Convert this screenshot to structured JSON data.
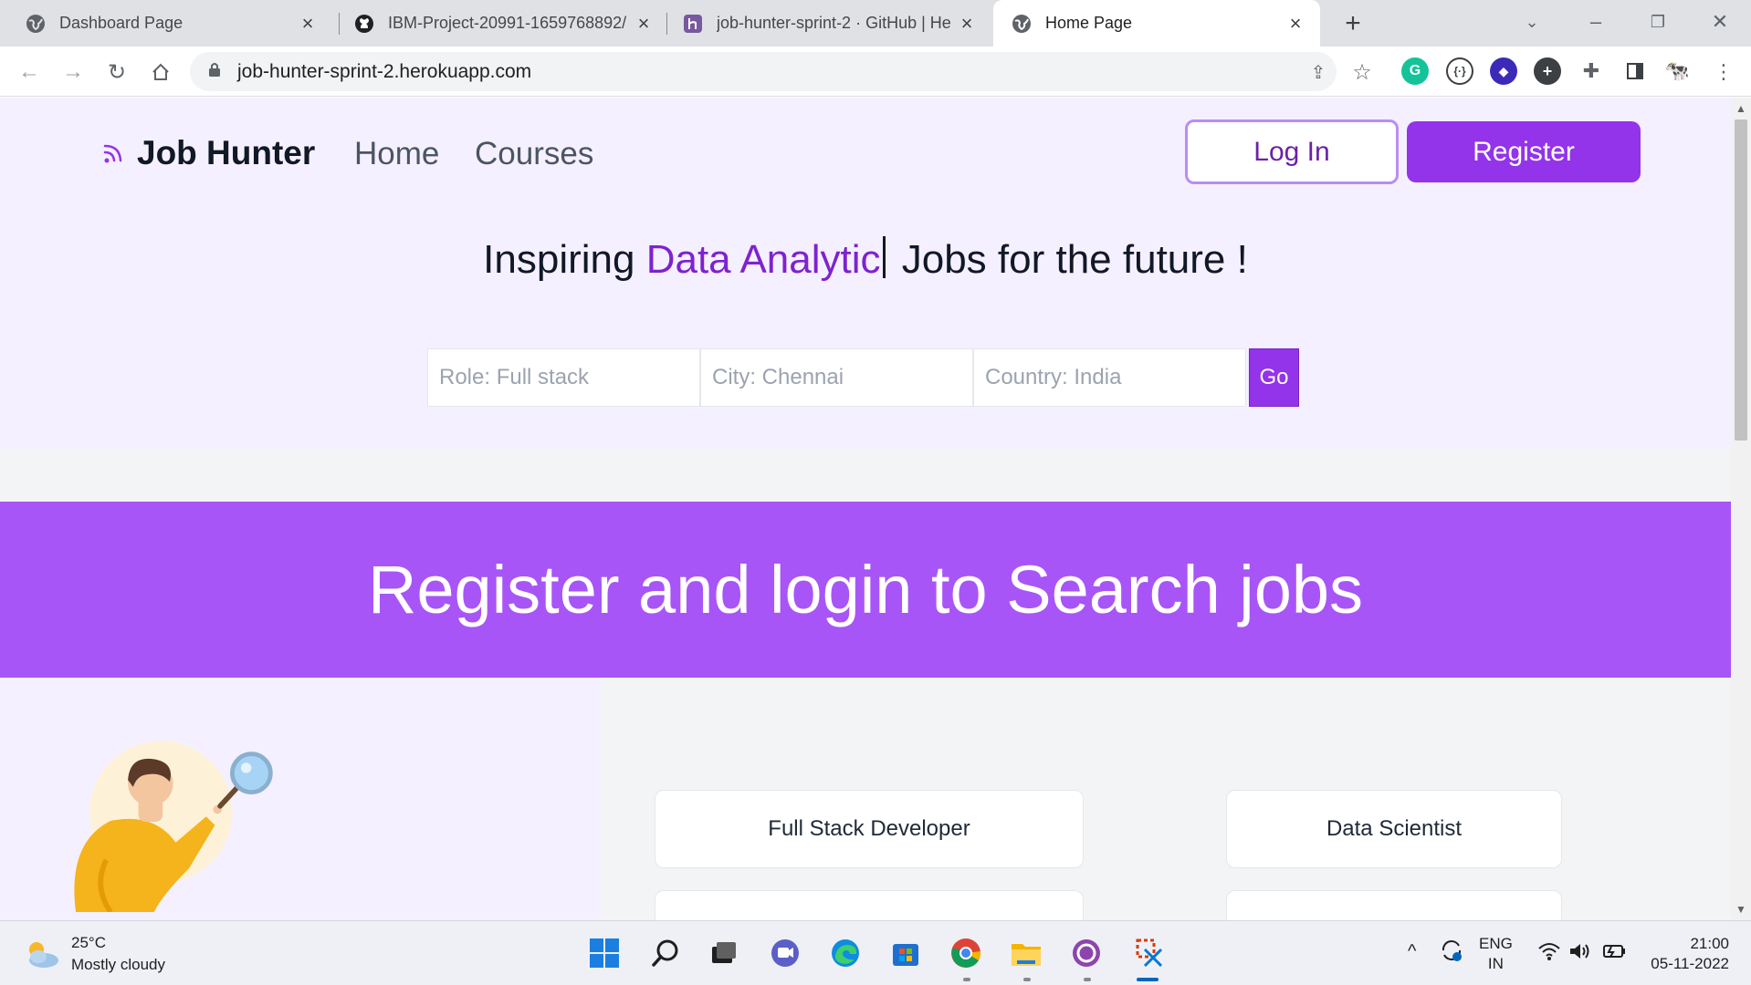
{
  "browser": {
    "tabs": [
      {
        "title": "Dashboard Page",
        "favicon": "globe-icon",
        "active": false
      },
      {
        "title": "IBM-Project-20991-1659768892/",
        "favicon": "github-icon",
        "active": false
      },
      {
        "title": "job-hunter-sprint-2 · GitHub | He",
        "favicon": "heroku-icon",
        "active": false
      },
      {
        "title": "Home Page",
        "favicon": "globe-icon",
        "active": true
      }
    ],
    "url": "job-hunter-sprint-2.herokuapp.com"
  },
  "site": {
    "brand": "Job Hunter",
    "nav": [
      "Home",
      "Courses"
    ],
    "login_label": "Log In",
    "register_label": "Register",
    "headline": {
      "prefix": "Inspiring ",
      "accent": "Data Analytic",
      "suffix": " Jobs for the future !"
    },
    "search": {
      "role_placeholder": "Role: Full stack",
      "city_placeholder": "City: Chennai",
      "country_placeholder": "Country: India",
      "go_label": "Go"
    },
    "banner": "Register and login to Search jobs",
    "cards": [
      "Full Stack Developer",
      "Data Scientist"
    ]
  },
  "taskbar": {
    "weather_temp": "25°C",
    "weather_desc": "Mostly cloudy",
    "lang_top": "ENG",
    "lang_bottom": "IN",
    "time": "21:00",
    "date": "05-11-2022"
  },
  "colors": {
    "accent": "#9333ea",
    "banner": "#a855f7",
    "hero_bg": "#f5f0ff"
  }
}
